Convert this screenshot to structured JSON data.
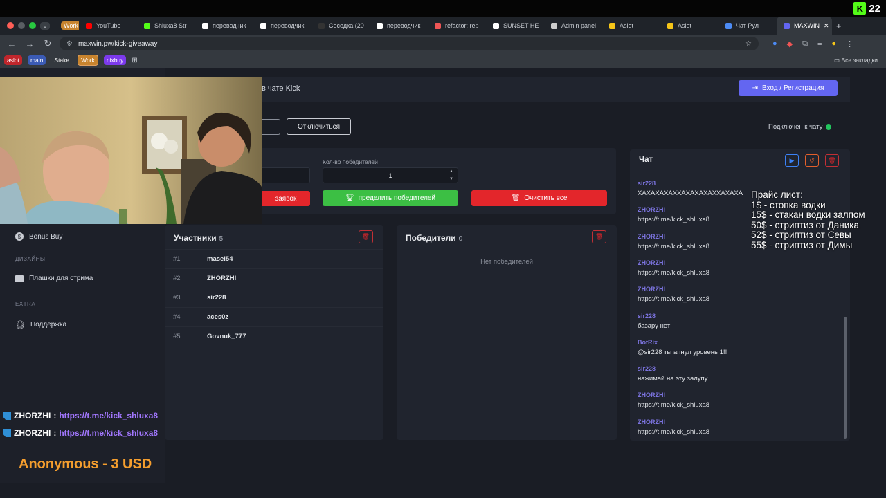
{
  "stream_badge": {
    "logo": "K",
    "viewers": "22"
  },
  "browser": {
    "tabs": [
      {
        "label": "Work",
        "color": "#c8842e"
      },
      {
        "label": "YouTube",
        "color": "#ff0000"
      },
      {
        "label": "Shluxa8 Str",
        "color": "#53fc18"
      },
      {
        "label": "переводчик",
        "color": "#ffffff"
      },
      {
        "label": "переводчик",
        "color": "#ffffff"
      },
      {
        "label": "Соседка (20",
        "color": "#333333"
      },
      {
        "label": "переводчик",
        "color": "#ffffff"
      },
      {
        "label": "refactor: rep",
        "color": "#e55"
      },
      {
        "label": "SUNSET HE",
        "color": "#ffffff"
      },
      {
        "label": "Admin panel",
        "color": "#cccccc"
      },
      {
        "label": "Aslot",
        "color": "#f5c518"
      },
      {
        "label": "Aslot",
        "color": "#f5c518"
      },
      {
        "label": "Чат Рул",
        "color": "#4c8bf5"
      },
      {
        "label": "MAXWIN",
        "color": "#6366f1"
      }
    ],
    "url": "maxwin.pw/kick-giveaway",
    "bookmarks": [
      {
        "label": "aslot",
        "color": "#c0262c"
      },
      {
        "label": "main",
        "color": "#3b5bb5"
      },
      {
        "label": "Stake",
        "color": "transparent"
      },
      {
        "label": "Work",
        "color": "#c8842e"
      },
      {
        "label": "nixbuy",
        "color": "#7c3aed"
      }
    ],
    "all_bookmarks": "Все закладки"
  },
  "sidebar": {
    "bonus_buy": "Bonus Buy",
    "section_designs": "ДИЗАЙНЫ",
    "stream_plates": "Плашки для стрима",
    "section_extra": "EXTRA",
    "support": "Поддержка"
  },
  "header": {
    "text_fragment": "в чате Kick",
    "login_button": "Вход / Регистрация"
  },
  "connection": {
    "disconnect_button": "Отключиться",
    "status": "Подключен к чату",
    "status_color": "#22c55e"
  },
  "controls": {
    "winners_count_label": "Кол-во победителей",
    "winners_count_value": "1",
    "red_button_fragment": "заявок",
    "pick_winners_fragment": "пределить победителей",
    "clear_all": "Очистить все"
  },
  "participants": {
    "title": "Участники",
    "count": "5",
    "rows": [
      {
        "idx": "#1",
        "name": "masel54"
      },
      {
        "idx": "#2",
        "name": "ZHORZHI"
      },
      {
        "idx": "#3",
        "name": "sir228"
      },
      {
        "idx": "#4",
        "name": "aces0z"
      },
      {
        "idx": "#5",
        "name": "Govnuk_777"
      }
    ]
  },
  "winners": {
    "title": "Победители",
    "count": "0",
    "empty": "Нет победителей"
  },
  "chat": {
    "title": "Чат",
    "messages": [
      {
        "user": "sir228",
        "text": "ХАХАХАХАХХАХАХАХАХХАХАХА"
      },
      {
        "user": "ZHORZHI",
        "text": "https://t.me/kick_shluxa8"
      },
      {
        "user": "ZHORZHI",
        "text": "https://t.me/kick_shluxa8"
      },
      {
        "user": "ZHORZHI",
        "text": "https://t.me/kick_shluxa8"
      },
      {
        "user": "ZHORZHI",
        "text": "https://t.me/kick_shluxa8"
      },
      {
        "user": "sir228",
        "text": "базару нет"
      },
      {
        "user": "BotRix",
        "text": "@sir228 ты апнул уровень 1!!"
      },
      {
        "user": "sir228",
        "text": "нажимай на эту залупу"
      },
      {
        "user": "ZHORZHI",
        "text": "https://t.me/kick_shluxa8"
      },
      {
        "user": "ZHORZHI",
        "text": "https://t.me/kick_shluxa8"
      }
    ]
  },
  "price_list": [
    "Прайс лист:",
    "1$ - стопка водки",
    "15$ - стакан водки залпом",
    "50$ - стриптиз от Даника",
    "52$ - стриптиз от Севы",
    "55$ - стриптиз от Димы"
  ],
  "overlay_chat": [
    {
      "user": "ZHORZHI",
      "sep": ":",
      "text": "https://t.me/kick_shluxa8"
    },
    {
      "user": "ZHORZHI",
      "sep": ":",
      "text": "https://t.me/kick_shluxa8"
    }
  ],
  "donation": "Anonymous - 3 USD"
}
